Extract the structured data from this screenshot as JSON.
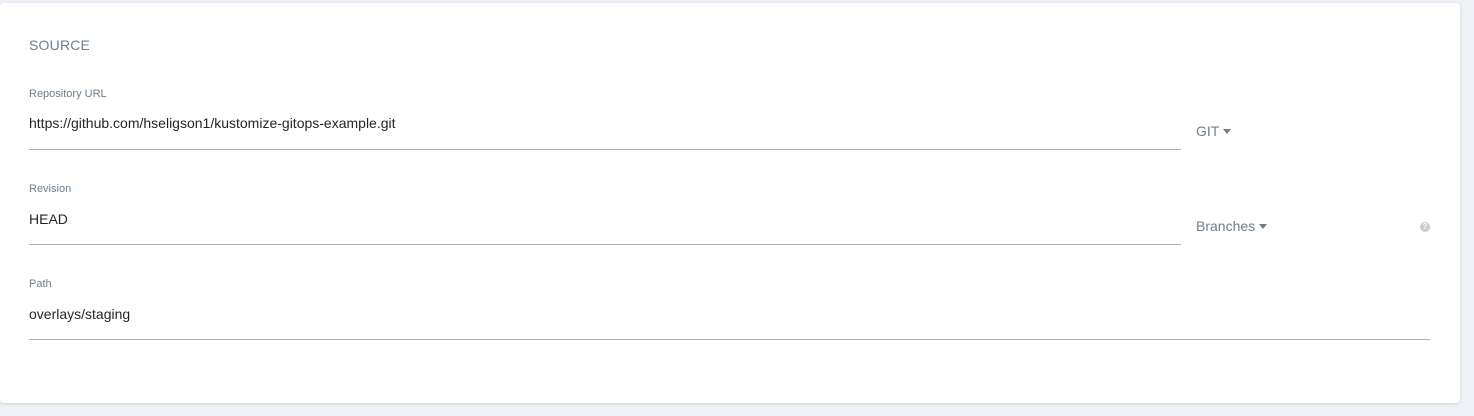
{
  "section": {
    "title": "SOURCE"
  },
  "fields": {
    "repo_url": {
      "label": "Repository URL",
      "value": "https://github.com/hseligson1/kustomize-gitops-example.git",
      "type_selector": "GIT"
    },
    "revision": {
      "label": "Revision",
      "value": "HEAD",
      "ref_selector": "Branches",
      "help_icon": "?"
    },
    "path": {
      "label": "Path",
      "value": "overlays/staging"
    }
  },
  "colors": {
    "label": "#6d7f8b",
    "text": "#1f2328",
    "underline": "#aab4bc",
    "background": "#eef1f5",
    "card": "#ffffff"
  },
  "icons": {
    "caret": "caret-down-icon",
    "help": "question-circle-icon"
  }
}
